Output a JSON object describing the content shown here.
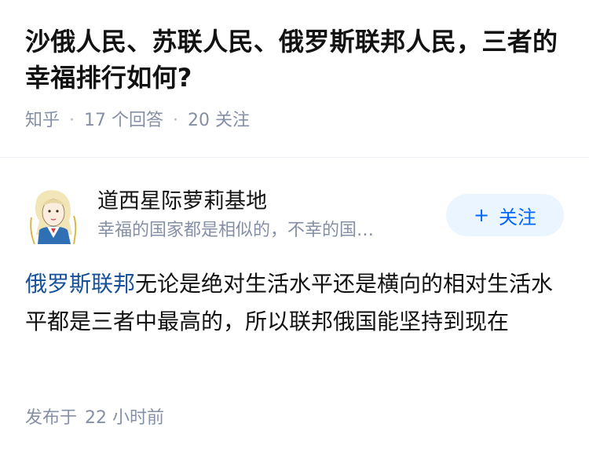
{
  "question": {
    "title": "沙俄人民、苏联人民、俄罗斯联邦人民，三者的幸福排行如何?",
    "source": "知乎",
    "answer_count": "17 个回答",
    "follower_count": "20 关注"
  },
  "author": {
    "name": "道西星际萝莉基地",
    "bio": "幸福的国家都是相似的，不幸的国…",
    "follow_label": "关注",
    "follow_icon": "plus-icon"
  },
  "answer": {
    "link_text": "俄罗斯联邦",
    "body": "无论是绝对生活水平还是横向的相对生活水平都是三者中最高的，所以联邦俄国能坚持到现在"
  },
  "footer": {
    "publish_label": "发布于",
    "publish_time": "22 小时前"
  },
  "colors": {
    "accent": "#0066ff",
    "link": "#175199",
    "meta": "#8590a6",
    "follow_bg": "#ebf5ff"
  }
}
